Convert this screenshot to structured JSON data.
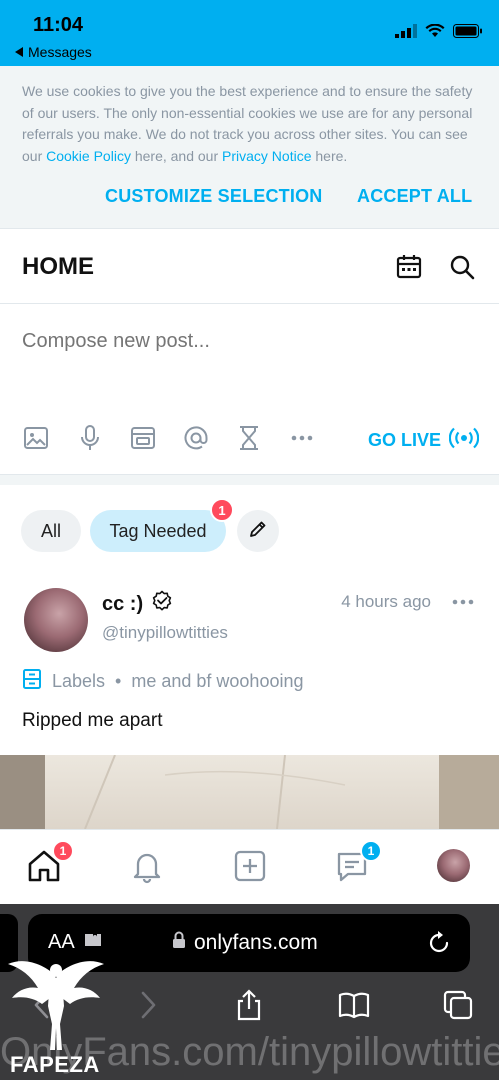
{
  "status_bar": {
    "time": "11:04",
    "back_label": "Messages"
  },
  "cookie_banner": {
    "text_before": "We use cookies to give you the best experience and to ensure the safety of our users. The only non-essential cookies we use are for any personal referrals you make. We do not track you across other sites. You can see our ",
    "cookie_policy_link": "Cookie Policy",
    "text_middle": " here, and our ",
    "privacy_notice_link": "Privacy Notice",
    "text_after": " here.",
    "customize_label": "CUSTOMIZE SELECTION",
    "accept_label": "ACCEPT ALL"
  },
  "header": {
    "title": "HOME"
  },
  "composer": {
    "placeholder": "Compose new post...",
    "go_live_label": "GO LIVE"
  },
  "filters": {
    "all_label": "All",
    "tag_needed_label": "Tag Needed",
    "tag_needed_count": "1"
  },
  "post": {
    "author_name": "cc :)",
    "author_handle": "@tinypillowtitties",
    "time_ago": "4 hours ago",
    "labels_title": "Labels",
    "label_value": "me and bf woohooing",
    "text": "Ripped me apart"
  },
  "bottom_nav": {
    "home_badge": "1",
    "messages_badge": "1"
  },
  "browser": {
    "aa_label": "AA",
    "url": "onlyfans.com"
  },
  "watermark": {
    "url_text": "OnlyFans.com/tinypillowtitties",
    "brand": "FAPEZA"
  },
  "colors": {
    "accent": "#00aff0",
    "badge": "#ff4a5c",
    "muted_text": "#8a96a3"
  }
}
